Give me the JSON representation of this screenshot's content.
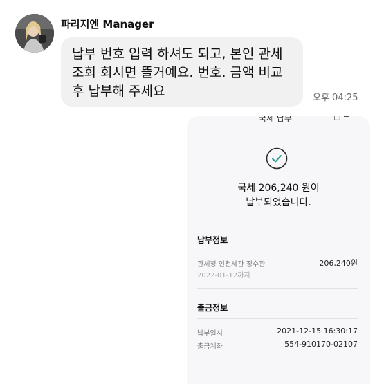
{
  "chat": {
    "sender_name": "파리지엔 Manager",
    "message_lines": [
      "납부 번호 입력 하셔도 되고, 본인 관세",
      "조회 회시면 뜰거예요. 번호. 금액 비교",
      "후 납부해 주세요"
    ],
    "time": "오후 04:25"
  },
  "receipt": {
    "top_label": "국세 납부",
    "top_icons": "□ ≡",
    "result_line1": "국세 206,240 원이",
    "result_line2": "납부되었습니다.",
    "payment_section_title": "납부정보",
    "payment_label": "관세청 인천세관 징수관",
    "payment_amount": "206,240원",
    "payment_due": "2022-01-12까지",
    "withdrawal_section_title": "출금정보",
    "paid_date_label": "납부일시",
    "paid_date_value": "2021-12-15 16:30:17",
    "account_label": "출금계좌",
    "account_value": "554-910170-02107"
  },
  "colors": {
    "bubble_bg": "#f1f1f1",
    "card_bg": "#f7f7f9",
    "check_color": "#2a9d8f"
  }
}
